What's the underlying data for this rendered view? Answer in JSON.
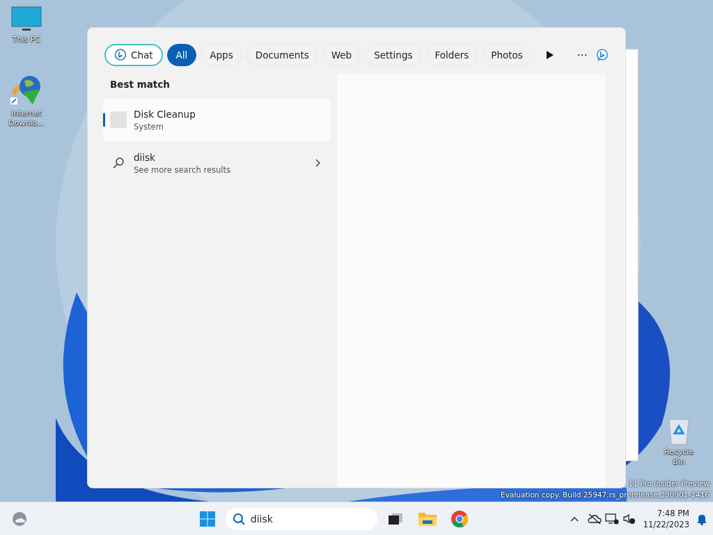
{
  "desktop_icons": [
    {
      "kind": "monitor",
      "label": "This PC"
    },
    {
      "kind": "app",
      "label": "Internet Downlo..."
    },
    {
      "kind": "bin",
      "label": "Recycle Bin"
    }
  ],
  "watermark": [
    "11 Pro Insider Preview",
    "Evaluation copy. Build 25947.rs_prerelease.230901-1416"
  ],
  "search_panel": {
    "filters": [
      {
        "kind": "chat",
        "label": "Chat",
        "selected": false
      },
      {
        "kind": "chip",
        "label": "All",
        "selected": true
      },
      {
        "kind": "chip",
        "label": "Apps",
        "selected": false
      },
      {
        "kind": "chip",
        "label": "Documents",
        "selected": false
      },
      {
        "kind": "chip",
        "label": "Web",
        "selected": false
      },
      {
        "kind": "chip",
        "label": "Settings",
        "selected": false
      },
      {
        "kind": "chip",
        "label": "Folders",
        "selected": false
      },
      {
        "kind": "chip",
        "label": "Photos",
        "selected": false
      }
    ],
    "more_button": "···",
    "heading": "Best match",
    "results": [
      {
        "kind": "app",
        "title": "Disk Cleanup",
        "subtitle": "System",
        "selected": true
      },
      {
        "kind": "web",
        "title": "diisk",
        "subtitle": "See more search results",
        "selected": false
      }
    ]
  },
  "taskbar": {
    "search_value": "diisk",
    "time": "7:48 PM",
    "date": "11/22/2023"
  }
}
